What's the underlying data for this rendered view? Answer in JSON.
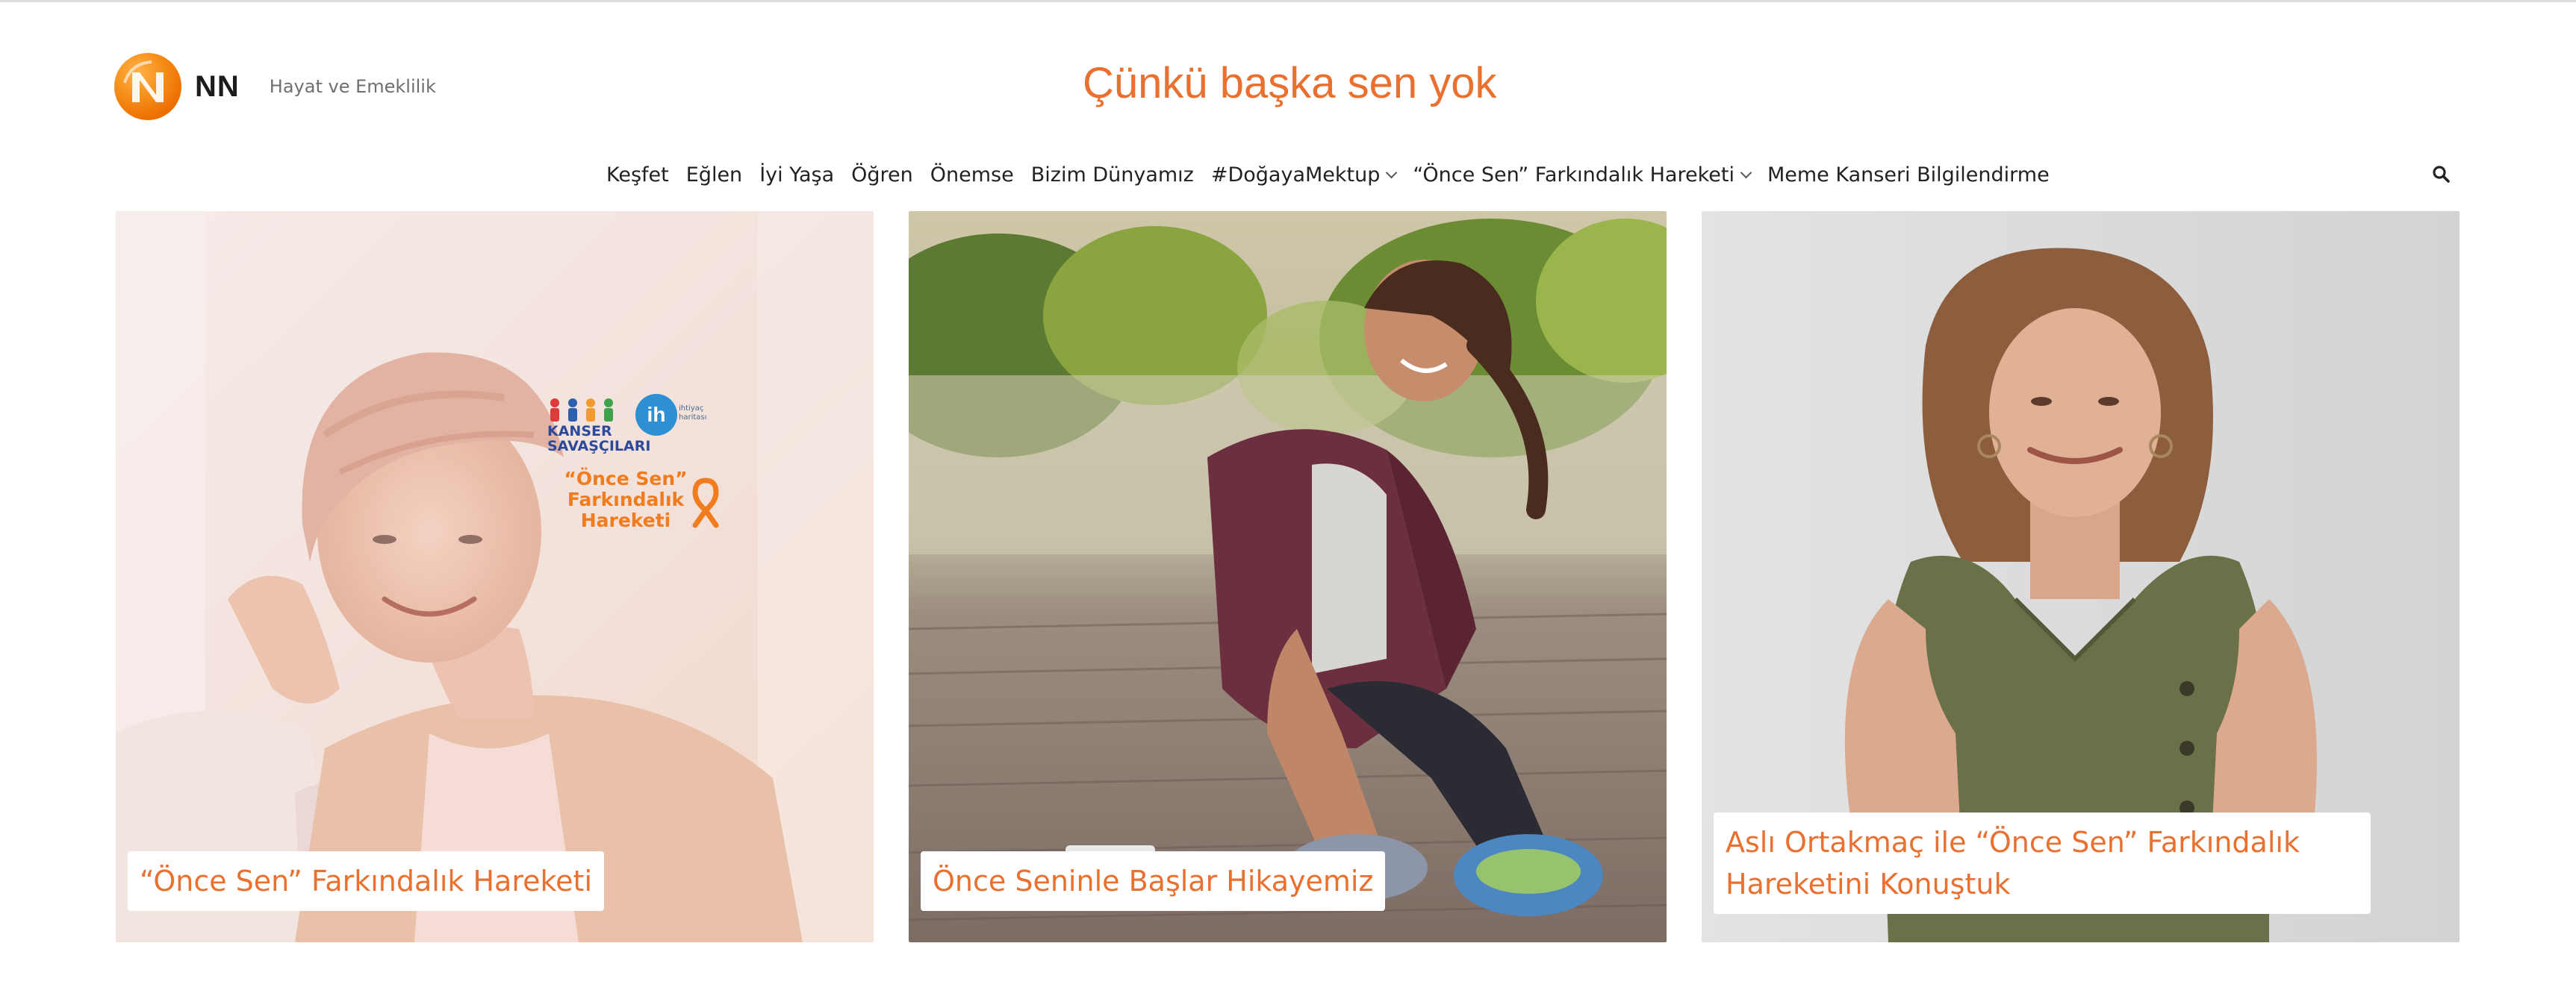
{
  "brand": {
    "wordmark": "NN",
    "tagline": "Hayat ve Emeklilik",
    "slogan": "Çünkü başka sen yok",
    "accent_color": "#e9702f",
    "logo_icon": "nn-lion-logo-icon"
  },
  "nav": {
    "items": [
      {
        "label": "Keşfet",
        "has_dropdown": false
      },
      {
        "label": "Eğlen",
        "has_dropdown": false
      },
      {
        "label": "İyi Yaşa",
        "has_dropdown": false
      },
      {
        "label": "Öğren",
        "has_dropdown": false
      },
      {
        "label": "Önemse",
        "has_dropdown": false
      },
      {
        "label": "Bizim Dünyamız",
        "has_dropdown": false
      },
      {
        "label": "#DoğayaMektup",
        "has_dropdown": true
      },
      {
        "label": "“Önce Sen” Farkındalık Hareketi",
        "has_dropdown": true
      },
      {
        "label": "Meme Kanseri Bilgilendirme",
        "has_dropdown": false
      }
    ],
    "search_icon": "search-icon"
  },
  "cards": [
    {
      "caption": "“Önce Sen” Farkındalık Hareketi",
      "image": "woman-with-headscarf-smiling-photo",
      "badge": {
        "org": "KANSER SAVAŞÇILARI",
        "ih": "ih",
        "ih_sub": "ihtiyaç haritası",
        "campaign_line1": "“Önce Sen”",
        "campaign_line2": "Farkındalık",
        "campaign_line3": "Hareketi"
      }
    },
    {
      "caption": "Önce Seninle Başlar Hikayemiz",
      "image": "woman-tying-running-shoes-photo"
    },
    {
      "caption": "Aslı Ortakmaç ile “Önce Sen” Farkındalık Hareketini Konuştuk",
      "image": "woman-in-green-top-portrait-photo"
    }
  ]
}
